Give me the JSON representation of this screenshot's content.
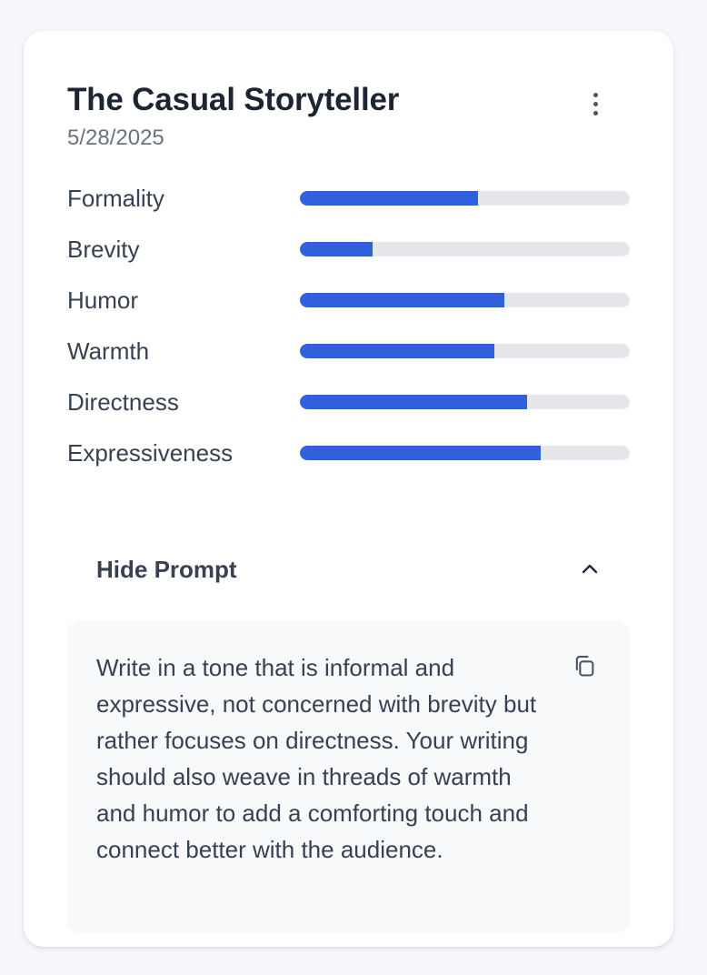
{
  "card": {
    "title": "The Casual Storyteller",
    "date": "5/28/2025",
    "menu_icon": "more-vertical-icon"
  },
  "metrics": [
    {
      "label": "Formality",
      "value": 0.54
    },
    {
      "label": "Brevity",
      "value": 0.22
    },
    {
      "label": "Humor",
      "value": 0.62
    },
    {
      "label": "Warmth",
      "value": 0.59
    },
    {
      "label": "Directness",
      "value": 0.69
    },
    {
      "label": "Expressiveness",
      "value": 0.73
    }
  ],
  "prompt_section": {
    "toggle_label": "Hide Prompt",
    "toggle_icon": "chevron-up-icon",
    "copy_icon": "copy-icon",
    "text": "Write in a tone that is informal and expressive, not concerned with brevity but rather focuses on directness. Your writing should also weave in threads of warmth and humor to add a comforting touch and connect better with the audience."
  },
  "colors": {
    "accent": "#3160dc",
    "track": "#e5e7eb",
    "card_background": "#ffffff",
    "page_background": "#f6f8fc",
    "prompt_background": "#f8f9fb"
  }
}
